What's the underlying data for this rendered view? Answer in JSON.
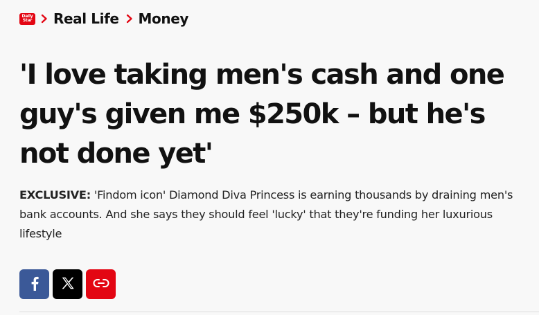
{
  "breadcrumb": {
    "logo_text": "Daily\nStar",
    "items": [
      {
        "label": "Real Life"
      },
      {
        "label": "Money"
      }
    ]
  },
  "article": {
    "headline": "'I love taking men's cash and one guy's given me $250k – but he's not done yet'",
    "standfirst_lead": "EXCLUSIVE:",
    "standfirst_body": " 'Findom icon' Diamond Diva Princess is earning thousands by draining men's bank accounts. And she says they should feel 'lucky' that they're funding her luxurious lifestyle"
  },
  "share": {
    "buttons": [
      {
        "icon": "facebook-icon",
        "color": "#3b5998"
      },
      {
        "icon": "x-icon",
        "color": "#000000"
      },
      {
        "icon": "link-icon",
        "color": "#e30613"
      }
    ]
  },
  "colors": {
    "brand": "#e30613",
    "text": "#111111",
    "background": "#f8f8f8"
  }
}
